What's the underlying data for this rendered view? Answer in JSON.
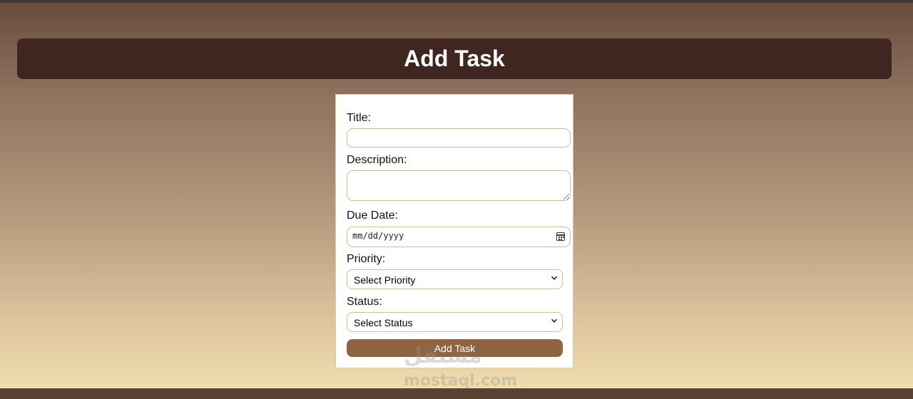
{
  "header": {
    "title": "Add Task"
  },
  "form": {
    "title_label": "Title:",
    "title_value": "",
    "description_label": "Description:",
    "description_value": "",
    "due_date_label": "Due Date:",
    "due_date_placeholder": "mm/dd/yyyy",
    "priority_label": "Priority:",
    "priority_selected": "Select Priority",
    "status_label": "Status:",
    "status_selected": "Select Status",
    "submit_label": "Add Task"
  },
  "watermark": {
    "arabic": "مستقل",
    "latin": "mostaql.com"
  },
  "colors": {
    "header_bg": "#3f2621",
    "button_bg": "#8f6440",
    "field_border": "#c9bd9c"
  },
  "icons": {
    "date": "calendar-icon",
    "select": "chevron-down-icon"
  }
}
